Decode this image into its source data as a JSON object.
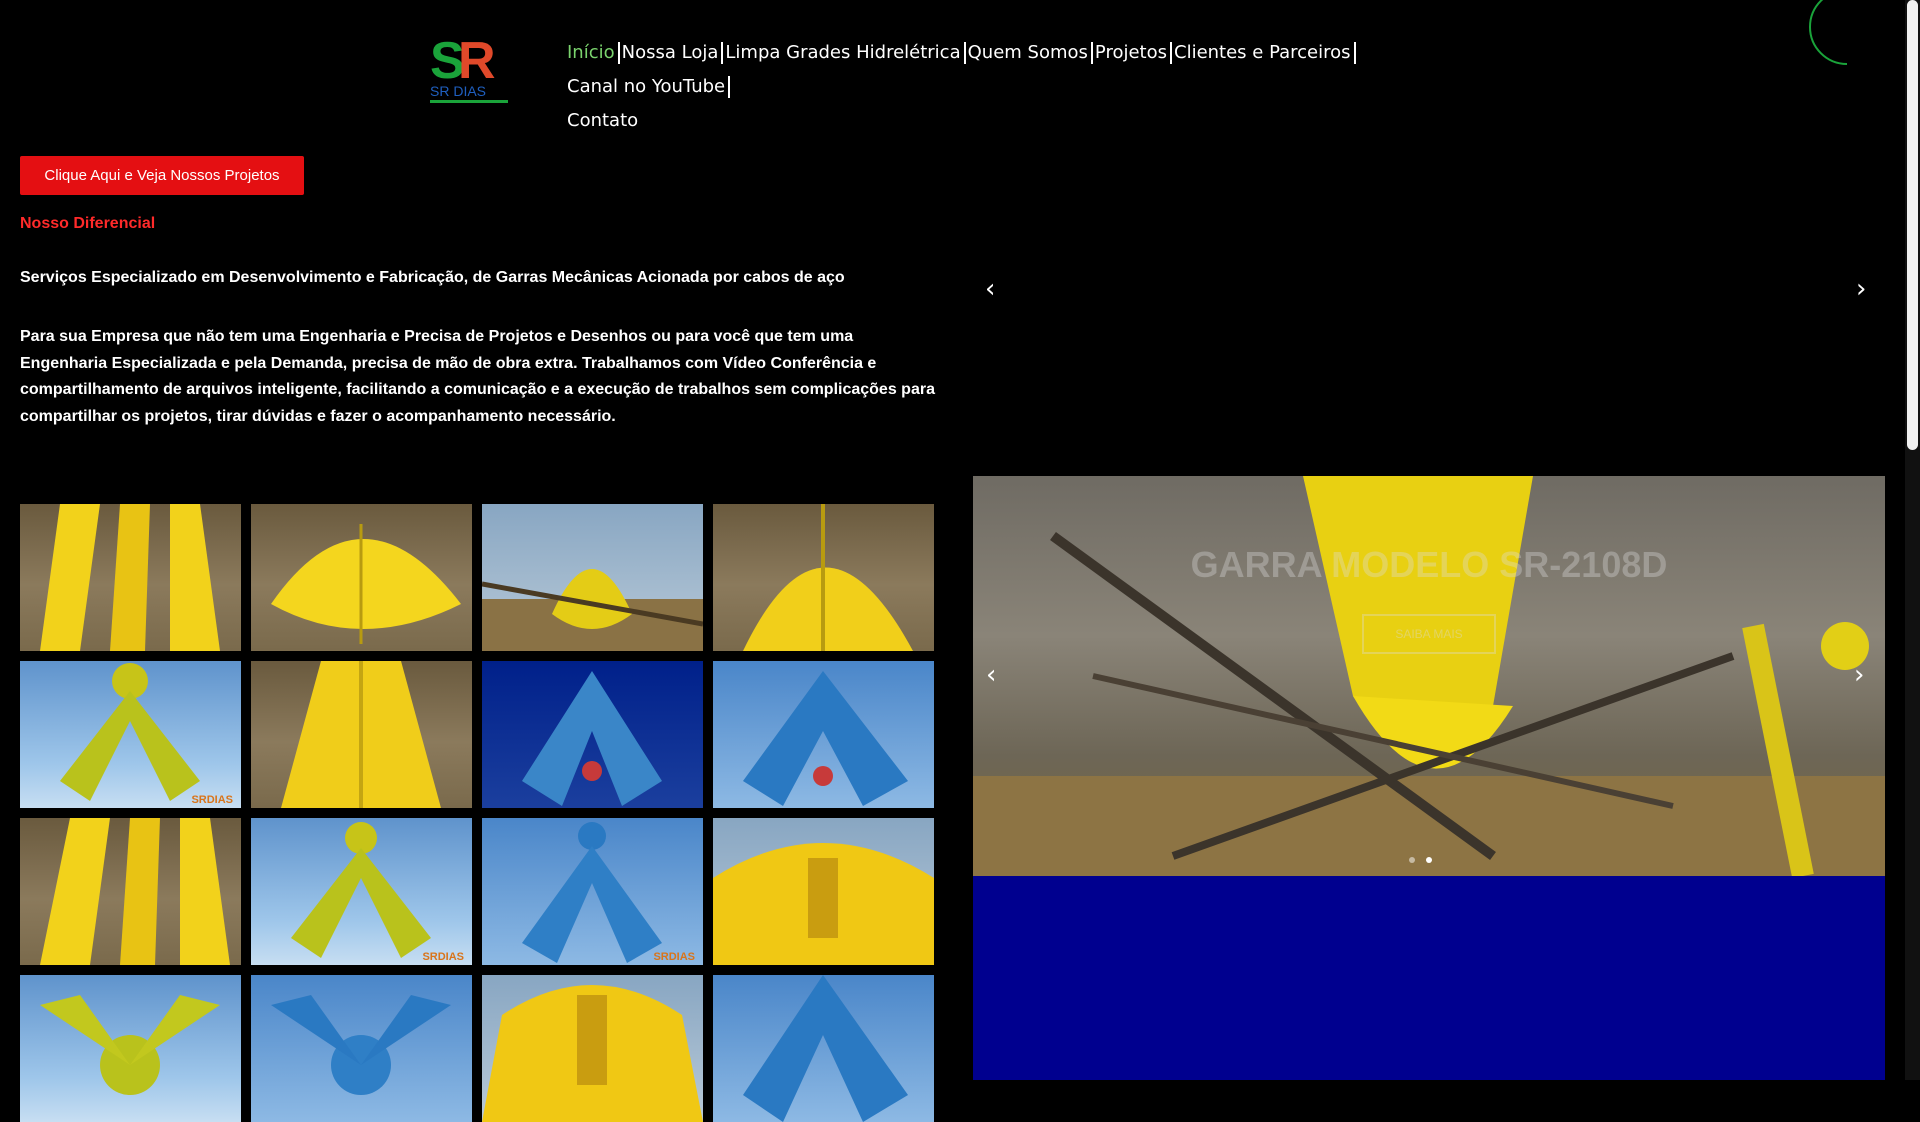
{
  "logo": {
    "text": "SR DIAS"
  },
  "nav": {
    "items": [
      {
        "label": "Início",
        "active": true
      },
      {
        "label": "Nossa Loja"
      },
      {
        "label": "Limpa Grades Hidrelétrica"
      },
      {
        "label": "Quem Somos"
      },
      {
        "label": "Projetos"
      },
      {
        "label": "Clientes e Parceiros"
      },
      {
        "label": "Canal no YouTube"
      },
      {
        "label": "Contato"
      }
    ]
  },
  "cta": {
    "label": "Clique Aqui e Veja Nossos Projetos"
  },
  "content": {
    "heading": "Nosso Diferencial",
    "intro": "Serviços Especializado em Desenvolvimento e Fabricação, de Garras Mecânicas Acionada por cabos de aço",
    "paragraph": "Para sua Empresa que não tem uma Engenharia e Precisa de Projetos e Desenhos ou para você que tem uma Engenharia Especializada e pela Demanda, precisa de mão de obra extra. Trabalhamos com Vídeo Conferência e compartilhamento de arquivos inteligente, facilitando a comunicação e a execução de trabalhos sem complicações para compartilhar os projetos, tirar dúvidas e fazer o acompanhamento necessário."
  },
  "gallery": {
    "brand_label": "SRDIAS"
  },
  "slider": {
    "title": "GARRA MODELO SR-2108D",
    "button_label": "SAIBA MAIS",
    "prev_icon": "‹",
    "next_icon": "›"
  },
  "colors": {
    "accent_red": "#e40f12",
    "nav_active": "#7ad36d",
    "blue_area": "#00008f"
  }
}
